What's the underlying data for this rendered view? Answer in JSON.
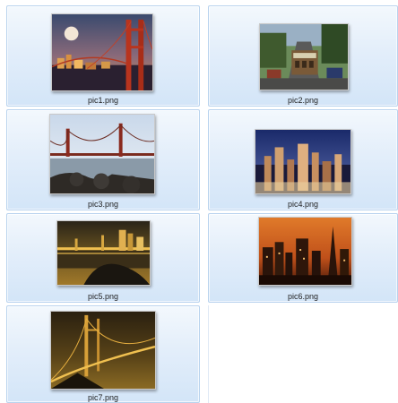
{
  "files": [
    {
      "name": "pic1.png",
      "thumbnail": "golden-gate-bridge-moon-night"
    },
    {
      "name": "pic2.png",
      "thumbnail": "cable-car-street"
    },
    {
      "name": "pic3.png",
      "thumbnail": "golden-gate-bridge-day"
    },
    {
      "name": "pic4.png",
      "thumbnail": "city-skyline-dusk"
    },
    {
      "name": "pic5.png",
      "thumbnail": "bay-bridge-night-reflection"
    },
    {
      "name": "pic6.png",
      "thumbnail": "transamerica-skyline-sunset"
    },
    {
      "name": "pic7.png",
      "thumbnail": "golden-gate-bridge-golden-night"
    }
  ],
  "colors": {
    "tile_border": "#b9d3ee",
    "tile_fill_top": "#f3f8fd",
    "tile_fill_bottom": "#d3e5f8",
    "label_text": "#1e1e1e"
  }
}
